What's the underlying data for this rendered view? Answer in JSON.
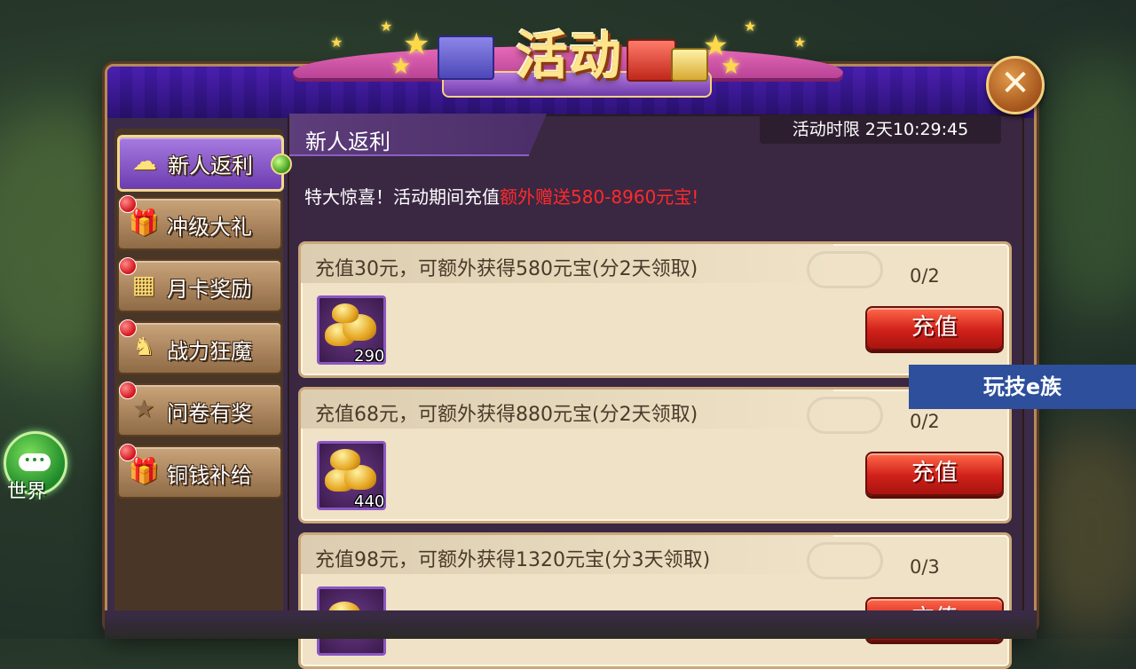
{
  "window": {
    "title": "活动",
    "close_icon": "close-icon"
  },
  "tabs": [
    {
      "label": "新人返利",
      "icon": "ingot-icon",
      "active": true,
      "badge": false
    },
    {
      "label": "冲级大礼",
      "icon": "gift-icon",
      "active": false,
      "badge": true
    },
    {
      "label": "月卡奖励",
      "icon": "card-icon",
      "active": false,
      "badge": true
    },
    {
      "label": "战力狂魔",
      "icon": "horse-icon",
      "active": false,
      "badge": true
    },
    {
      "label": "问卷有奖",
      "icon": "star-icon",
      "active": false,
      "badge": true
    },
    {
      "label": "铜钱补给",
      "icon": "gift-icon",
      "active": false,
      "badge": true
    }
  ],
  "section": {
    "title": "新人返利",
    "timer": "活动时限 2天10:29:45"
  },
  "promo": {
    "text": "特大惊喜！活动期间充值",
    "highlight": "额外赠送580-8960元宝!"
  },
  "rewards": [
    {
      "description": "充值30元，可额外获得580元宝(分2天领取)",
      "progress": "0/2",
      "item_count": "290",
      "button": "充值"
    },
    {
      "description": "充值68元，可额外获得880元宝(分2天领取)",
      "progress": "0/2",
      "item_count": "440",
      "button": "充值"
    },
    {
      "description": "充值98元，可额外获得1320元宝(分3天领取)",
      "progress": "0/3",
      "item_count": "",
      "button": "充值"
    }
  ],
  "watermark": "玩技e族",
  "world": {
    "label": "世界",
    "dots": "•••"
  },
  "colors": {
    "accent_purple": "#6c3cb0",
    "button_red": "#d0201a",
    "highlight_red": "#ff2a2a",
    "gold": "#ffe48a"
  }
}
